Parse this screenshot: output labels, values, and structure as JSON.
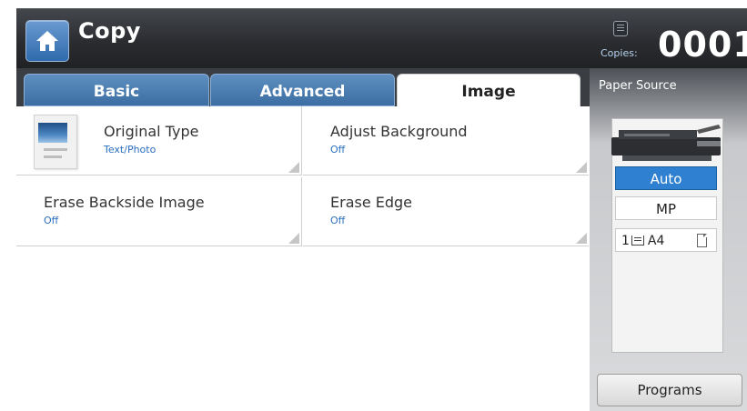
{
  "header": {
    "title": "Copy",
    "copies_label": "Copies:",
    "copies_count": "0001"
  },
  "tabs": [
    {
      "label": "Basic",
      "active": false
    },
    {
      "label": "Advanced",
      "active": false
    },
    {
      "label": "Image",
      "active": true
    }
  ],
  "options": [
    {
      "title": "Original Type",
      "value": "Text/Photo"
    },
    {
      "title": "Adjust Background",
      "value": "Off"
    },
    {
      "title": "Erase Backside Image",
      "value": "Off"
    },
    {
      "title": "Erase Edge",
      "value": "Off"
    }
  ],
  "paper_source": {
    "label": "Paper Source",
    "sources": [
      {
        "label": "Auto",
        "selected": true
      },
      {
        "label": "MP",
        "selected": false
      },
      {
        "tray_number": "1",
        "paper_size": "A4",
        "selected": false
      }
    ]
  },
  "programs_button": "Programs",
  "colors": {
    "accent": "#2f80d0",
    "value_text": "#2a6fbf",
    "header_bg": "#2a2c30"
  },
  "icons": {
    "home": "home-icon",
    "copies": "counter-icon",
    "tray": "tray-icon",
    "paper": "paper-icon",
    "printer": "printer-icon"
  }
}
